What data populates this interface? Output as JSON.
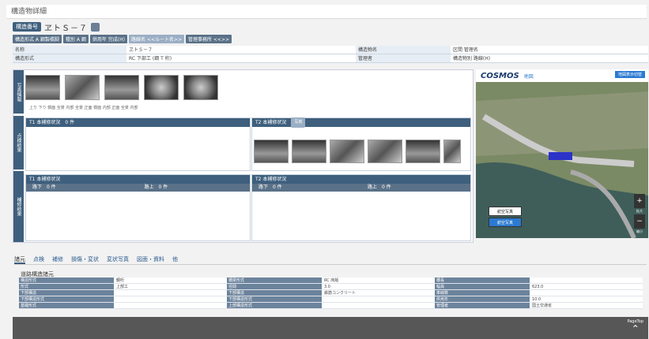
{
  "header": {
    "title": "構造物詳細"
  },
  "structure": {
    "badge": "構造番号",
    "number": "ヱトＳ－７",
    "edit_icon": "pencil-icon"
  },
  "tags": [
    "構造形式 A 鋼製橋脚",
    "種別 A 鋼",
    "供用年 完成(H)",
    "路線名 <<ルート名>>",
    "管理事務所 <<>>"
  ],
  "info": [
    {
      "l1": "名称",
      "v1": "ヱトＳ－７",
      "l2": "構造物名",
      "v2": "区間 管理名"
    },
    {
      "l1": "構造形式",
      "v1": "RC 下部工 (鋼 T 桁)",
      "l2": "管理者",
      "v2": "構造物別 路線(H)"
    }
  ],
  "photos": {
    "captions": "上り 下り 側面 全景 内部  全景  正面 側面 内部 正面 全景 内部",
    "items": [
      "photo-1",
      "photo-2",
      "photo-3",
      "photo-4",
      "photo-5"
    ]
  },
  "panels": {
    "t1_upper": {
      "title": "T1 本補修状況",
      "count": "0 件"
    },
    "t2_upper": {
      "title": "T2 本補修状況",
      "badge": "写真"
    },
    "t1_lower": {
      "title": "T1 本補修状況",
      "sub_left": "路下",
      "sub_right": "路上",
      "count": "0 件"
    },
    "t2_lower": {
      "title": "T2 本補修状況",
      "sub_left": "路下",
      "sub_right": "路上",
      "count": "0 件"
    }
  },
  "side_tabs": {
    "photos": "写真情報",
    "inspection": "点検結果",
    "repair": "補修結果"
  },
  "map": {
    "brand": "COSMOS",
    "sub": "地図",
    "button": "地図表示切替",
    "zoom_in": "+",
    "zoom_out": "−",
    "zoom_in_label": "拡大",
    "zoom_out_label": "縮小",
    "ctrl_1": "航空写真",
    "ctrl_2": "航空写真"
  },
  "tabs": [
    "諸元",
    "点検",
    "補修",
    "損傷・変状",
    "変状写真",
    "図面・資料",
    "他"
  ],
  "bottom": {
    "title": "道路構造諸元",
    "col1": [
      {
        "l": "構造形式",
        "v": "鋼桁"
      },
      {
        "l": "形式",
        "v": "上部工"
      },
      {
        "l": "下部構造",
        "v": ""
      },
      {
        "l": "下部構造形式",
        "v": ""
      },
      {
        "l": "基礎形式",
        "v": ""
      }
    ],
    "col2": [
      {
        "l": "橋梁形式",
        "v": "RC 床版"
      },
      {
        "l": "径間",
        "v": "3.0"
      },
      {
        "l": "下部構造",
        "v": "鉄筋コンクリート"
      },
      {
        "l": "下部構造形式",
        "v": ""
      },
      {
        "l": "上部構造形式",
        "v": ""
      }
    ],
    "col3": [
      {
        "l": "橋長",
        "v": ""
      },
      {
        "l": "幅員",
        "v": "623.0"
      },
      {
        "l": "車線数",
        "v": ""
      },
      {
        "l": "供用年",
        "v": "10.0"
      },
      {
        "l": "管理者",
        "v": "国土交通省"
      }
    ]
  },
  "footer": {
    "pagetop": "PageTop"
  }
}
